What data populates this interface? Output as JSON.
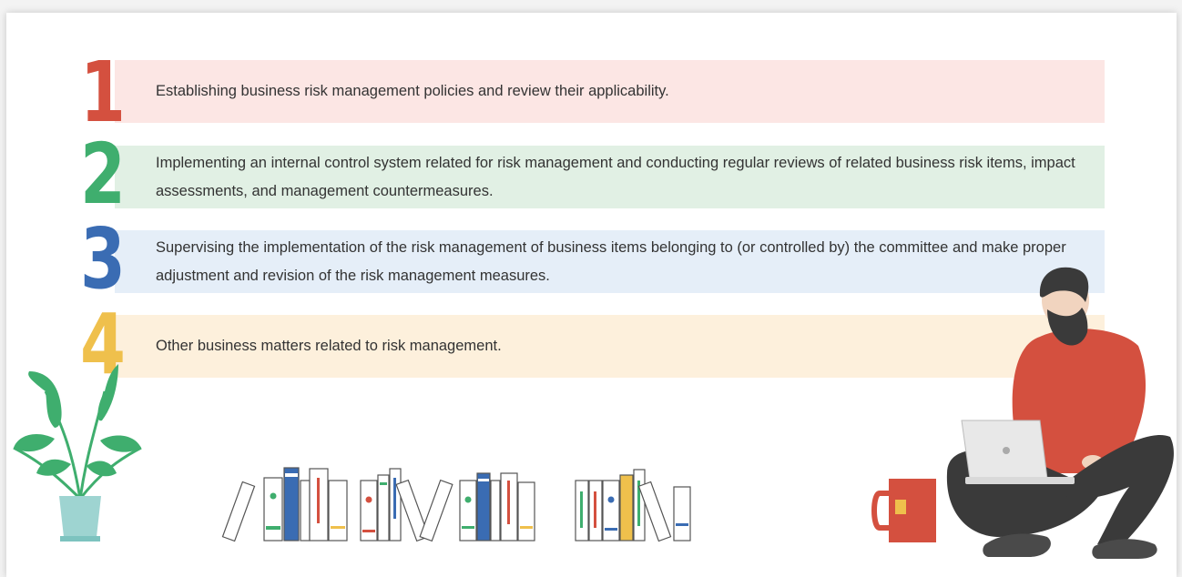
{
  "colors": {
    "accent_red": "#d4503f",
    "accent_green": "#3fae6e",
    "accent_blue": "#3a6cb3",
    "accent_yellow": "#efc04c",
    "bg_red": "#fce6e4",
    "bg_green": "#e1f0e4",
    "bg_blue": "#e5eef8",
    "bg_yellow": "#fdf0dc"
  },
  "items": [
    {
      "number": "1",
      "text": "Establishing business risk management policies and review their applicability."
    },
    {
      "number": "2",
      "text": "Implementing an internal control system related for risk management and conducting regular reviews of related business risk items, impact assessments, and management countermeasures."
    },
    {
      "number": "3",
      "text": "Supervising the implementation of the risk management of business items belonging to (or controlled by) the committee and make proper adjustment and revision of the risk management measures."
    },
    {
      "number": "4",
      "text": "Other business matters related to risk management."
    }
  ],
  "icons": [
    "plant-icon",
    "books-icon",
    "person-with-laptop-icon",
    "tea-mug-icon"
  ]
}
